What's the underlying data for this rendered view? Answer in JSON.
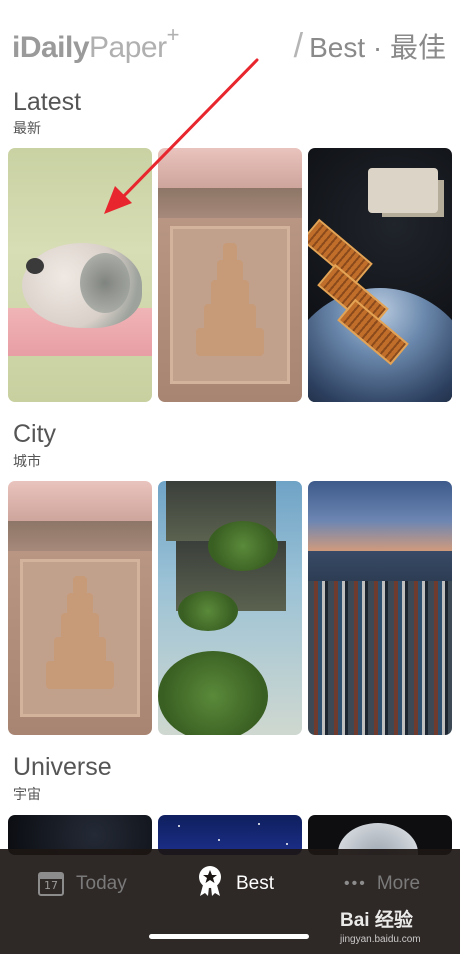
{
  "header": {
    "logo_i": "iDaily",
    "logo_paper": "Paper",
    "logo_sup": "+",
    "section_title": "Best · 最佳"
  },
  "sections": [
    {
      "title": "Latest",
      "subtitle": "最新"
    },
    {
      "title": "City",
      "subtitle": "城市"
    },
    {
      "title": "Universe",
      "subtitle": "宇宙"
    }
  ],
  "tabbar": {
    "today_label": "Today",
    "today_date": "17",
    "best_label": "Best",
    "more_label": "More",
    "more_dots": "•••"
  },
  "watermark": {
    "logo": "Bai 经验",
    "sub": "jingyan.baidu.com"
  },
  "icons": [
    "calendar-icon",
    "award-star-icon",
    "more-dots-icon"
  ],
  "colors": {
    "arrow": "#e8262d",
    "tabbar_bg": "#1c1614",
    "tab_active": "#ffffff",
    "tab_inactive": "#7a7a7a"
  }
}
